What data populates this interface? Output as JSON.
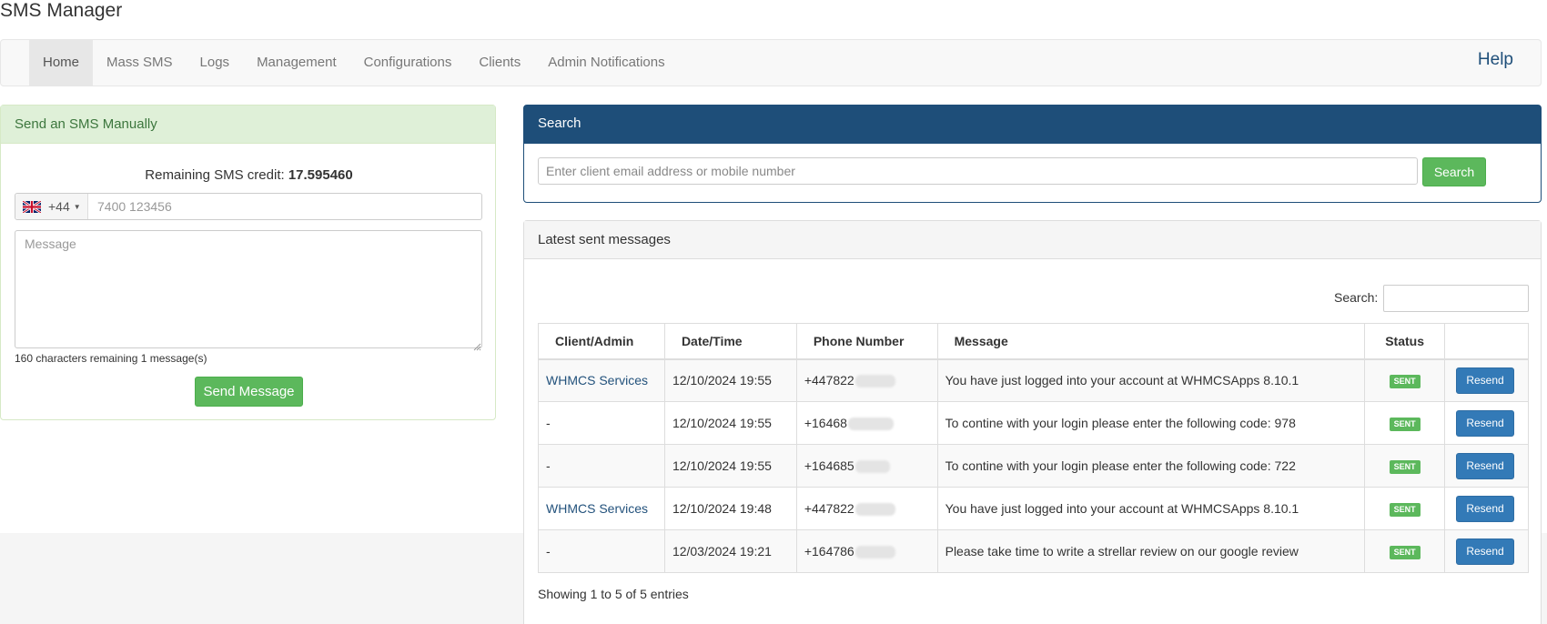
{
  "app_title": "SMS Manager",
  "nav": {
    "items": [
      "Home",
      "Mass SMS",
      "Logs",
      "Management",
      "Configurations",
      "Clients",
      "Admin Notifications"
    ],
    "active": "Home",
    "help": "Help"
  },
  "send_panel": {
    "title": "Send an SMS Manually",
    "credit_label": "Remaining SMS credit: ",
    "credit_value": "17.595460",
    "country_flag": "uk-flag-icon",
    "dial_code": "+44",
    "phone_placeholder": "7400 123456",
    "message_placeholder": "Message",
    "chars_remaining": "160 characters remaining",
    "message_count": "1 message(s)",
    "send_button": "Send Message"
  },
  "search_panel": {
    "title": "Search",
    "placeholder": "Enter client email address or mobile number",
    "button": "Search"
  },
  "messages_panel": {
    "title": "Latest sent messages",
    "search_label": "Search:",
    "columns": [
      "Client/Admin",
      "Date/Time",
      "Phone Number",
      "Message",
      "Status",
      ""
    ],
    "rows": [
      {
        "client": "WHMCS Services",
        "datetime": "12/10/2024 19:55",
        "phone": "+447822",
        "message": "You have just logged into your account at WHMCSApps 8.10.1",
        "status": "SENT",
        "action": "Resend"
      },
      {
        "client": "-",
        "datetime": "12/10/2024 19:55",
        "phone": "+16468",
        "message": "To contine with your login please enter the following code: 978",
        "status": "SENT",
        "action": "Resend"
      },
      {
        "client": "-",
        "datetime": "12/10/2024 19:55",
        "phone": "+164685",
        "message": "To contine with your login please enter the following code: 722",
        "status": "SENT",
        "action": "Resend"
      },
      {
        "client": "WHMCS Services",
        "datetime": "12/10/2024 19:48",
        "phone": "+447822",
        "message": "You have just logged into your account at WHMCSApps 8.10.1",
        "status": "SENT",
        "action": "Resend"
      },
      {
        "client": "-",
        "datetime": "12/03/2024 19:21",
        "phone": "+164786",
        "message": "Please take time to write a strellar review on our google review",
        "status": "SENT",
        "action": "Resend"
      }
    ],
    "footer": "Showing 1 to 5 of 5 entries"
  },
  "colors": {
    "primary": "#1e4e79",
    "success": "#5cb85c",
    "resend": "#337ab7",
    "panel_success_bg": "#dff0d8"
  }
}
